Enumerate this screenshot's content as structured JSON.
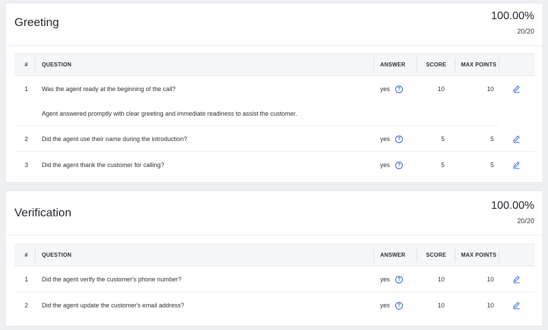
{
  "sections": [
    {
      "title": "Greeting",
      "percent": "100.00%",
      "fraction": "20/20",
      "headers": {
        "num": "#",
        "question": "QUESTION",
        "answer": "ANSWER",
        "score": "SCORE",
        "max": "MAX POINTS"
      },
      "rows": [
        {
          "num": "1",
          "question": "Was the agent ready at the beginning of the call?",
          "answer": "yes",
          "score": "10",
          "max": "10",
          "note": "Agent answered promptly with clear greeting and immediate readiness to assist the customer."
        },
        {
          "num": "2",
          "question": "Did the agent use their name during the introduction?",
          "answer": "yes",
          "score": "5",
          "max": "5"
        },
        {
          "num": "3",
          "question": "Did the agent thank the customer for calling?",
          "answer": "yes",
          "score": "5",
          "max": "5"
        }
      ]
    },
    {
      "title": "Verification",
      "percent": "100.00%",
      "fraction": "20/20",
      "headers": {
        "num": "#",
        "question": "QUESTION",
        "answer": "ANSWER",
        "score": "SCORE",
        "max": "MAX POINTS"
      },
      "rows": [
        {
          "num": "1",
          "question": "Did the agent verify the customer's phone number?",
          "answer": "yes",
          "score": "10",
          "max": "10"
        },
        {
          "num": "2",
          "question": "Did the agent update the customer's email address?",
          "answer": "yes",
          "score": "10",
          "max": "10"
        }
      ]
    }
  ],
  "icons": {
    "help": "question-circle-icon",
    "edit": "pencil-edit-icon"
  },
  "colors": {
    "accent": "#2a5bd7"
  }
}
